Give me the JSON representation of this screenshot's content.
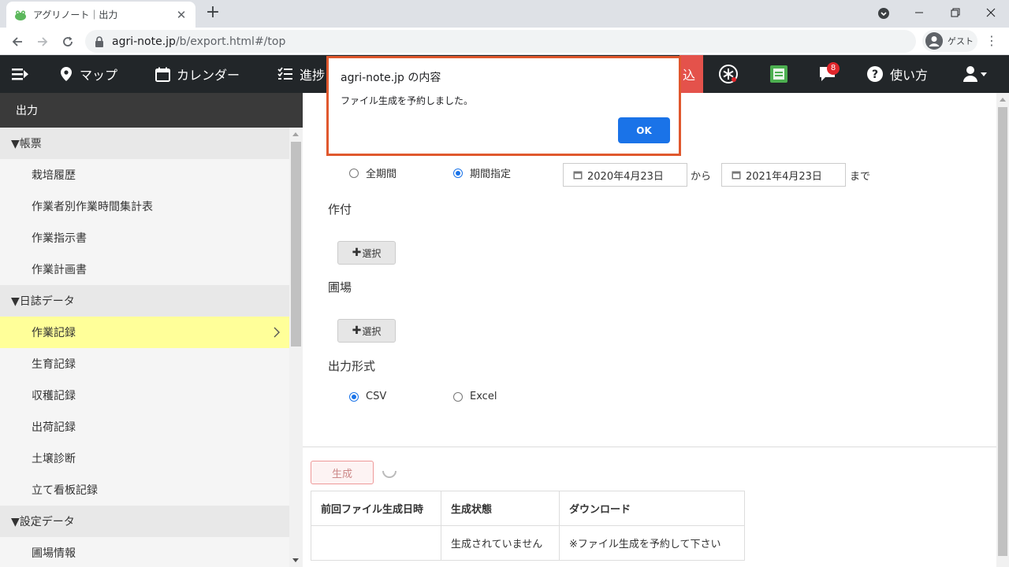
{
  "browser": {
    "tab_title": "アグリノート｜出力",
    "tab_close": "✕",
    "new_tab": "+",
    "url_host": "agri-note.jp",
    "url_path": "/b/export.html#/top",
    "profile_label": "ゲスト",
    "menu_glyph": "⋮"
  },
  "appbar": {
    "map": "マップ",
    "calendar": "カレンダー",
    "progress": "進捗",
    "red_fragment": "込",
    "notifications_count": "8",
    "help": "使い方"
  },
  "sidebar": {
    "header": "出力",
    "groups": [
      {
        "label": "▼帳票",
        "items": [
          "栽培履歴",
          "作業者別作業時間集計表",
          "作業指示書",
          "作業計画書"
        ]
      },
      {
        "label": "▼日誌データ",
        "items": [
          "作業記録",
          "生育記録",
          "収穫記録",
          "出荷記録",
          "土壌診断",
          "立て看板記録"
        ]
      },
      {
        "label": "▼設定データ",
        "items": [
          "圃場情報"
        ]
      }
    ],
    "active_item": "作業記録"
  },
  "form": {
    "period_all": "全期間",
    "period_range": "期間指定",
    "date_from": "2020年4月23日",
    "kara": "から",
    "date_to": "2021年4月23日",
    "made": "まで",
    "crop_label": "作付",
    "field_label": "圃場",
    "select_button": "選択",
    "format_label": "出力形式",
    "format_csv": "CSV",
    "format_excel": "Excel"
  },
  "generate": {
    "button": "生成",
    "table_headers": [
      "前回ファイル生成日時",
      "生成状態",
      "ダウンロード"
    ],
    "row": [
      "",
      "生成されていません",
      "※ファイル生成を予約して下さい"
    ]
  },
  "dialog": {
    "title": "agri-note.jp の内容",
    "message": "ファイル生成を予約しました。",
    "ok": "OK",
    "border_color": "#e0582e"
  }
}
